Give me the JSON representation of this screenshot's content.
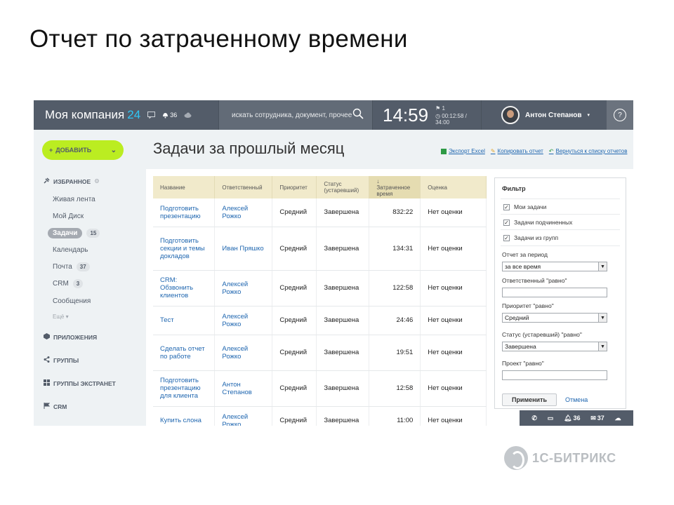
{
  "slide": {
    "title": "Отчет по затраченному времени"
  },
  "topbar": {
    "brand": "Моя компания",
    "brand_num": "24",
    "notif_count": "36",
    "search_placeholder": "искать сотрудника, документ, прочее",
    "clock_time": "14:59",
    "clock_flag": "1",
    "clock_timer": "00:12:58 / 34:00",
    "user_name": "Антон Степанов",
    "help": "?"
  },
  "sidebar": {
    "add_label": "ДОБАВИТЬ",
    "favorites": "ИЗБРАННОЕ",
    "items": [
      {
        "label": "Живая лента"
      },
      {
        "label": "Мой Диск"
      },
      {
        "label": "Задачи",
        "count": "15"
      },
      {
        "label": "Календарь"
      },
      {
        "label": "Почта",
        "count": "37"
      },
      {
        "label": "CRM",
        "count": "3"
      },
      {
        "label": "Сообщения"
      }
    ],
    "more": "Ещё",
    "sections": [
      "ПРИЛОЖЕНИЯ",
      "ГРУППЫ",
      "ГРУППЫ ЭКСТРАНЕТ",
      "CRM"
    ]
  },
  "main": {
    "title": "Задачи за прошлый месяц",
    "actions": [
      "Экспорт Excel",
      "Копировать отчет",
      "Вернуться к списку отчетов"
    ]
  },
  "table": {
    "headers": [
      "Название",
      "Ответственный",
      "Приоритет",
      "Статус (устаревший)",
      "↓ Затраченное время",
      "Оценка"
    ],
    "rows": [
      {
        "name": "Подготовить презентацию",
        "resp": "Алексей Рожко",
        "prio": "Средний",
        "status": "Завершена",
        "time": "832:22",
        "mark": "Нет оценки"
      },
      {
        "name": "Подготовить секции и темы докладов",
        "resp": "Иван Пряшко",
        "prio": "Средний",
        "status": "Завершена",
        "time": "134:31",
        "mark": "Нет оценки"
      },
      {
        "name": "CRM: Обзвонить клиентов",
        "resp": "Алексей Рожко",
        "prio": "Средний",
        "status": "Завершена",
        "time": "122:58",
        "mark": "Нет оценки"
      },
      {
        "name": "Тест",
        "resp": "Алексей Рожко",
        "prio": "Средний",
        "status": "Завершена",
        "time": "24:46",
        "mark": "Нет оценки"
      },
      {
        "name": "Сделать отчет по работе",
        "resp": "Алексей Рожко",
        "prio": "Средний",
        "status": "Завершена",
        "time": "19:51",
        "mark": "Нет оценки"
      },
      {
        "name": "Подготовить презентацию для клиента",
        "resp": "Антон Степанов",
        "prio": "Средний",
        "status": "Завершена",
        "time": "12:58",
        "mark": "Нет оценки"
      },
      {
        "name": "Купить слона",
        "resp": "Алексей Рожко",
        "prio": "Средний",
        "status": "Завершена",
        "time": "11:00",
        "mark": "Нет оценки"
      }
    ]
  },
  "filter": {
    "title": "Фильтр",
    "checks": [
      "Мои задачи",
      "Задачи подчиненных",
      "Задачи из групп"
    ],
    "period_label": "Отчет за период",
    "period_value": "за все время",
    "resp_label": "Ответственный \"равно\"",
    "prio_label": "Приоритет \"равно\"",
    "prio_value": "Средний",
    "status_label": "Статус (устаревший) \"равно\"",
    "status_value": "Завершена",
    "project_label": "Проект \"равно\"",
    "apply": "Применить",
    "cancel": "Отмена"
  },
  "chatbar": {
    "notif": "36",
    "mail": "37"
  },
  "logo": {
    "text": "1С-БИТРИКС"
  }
}
